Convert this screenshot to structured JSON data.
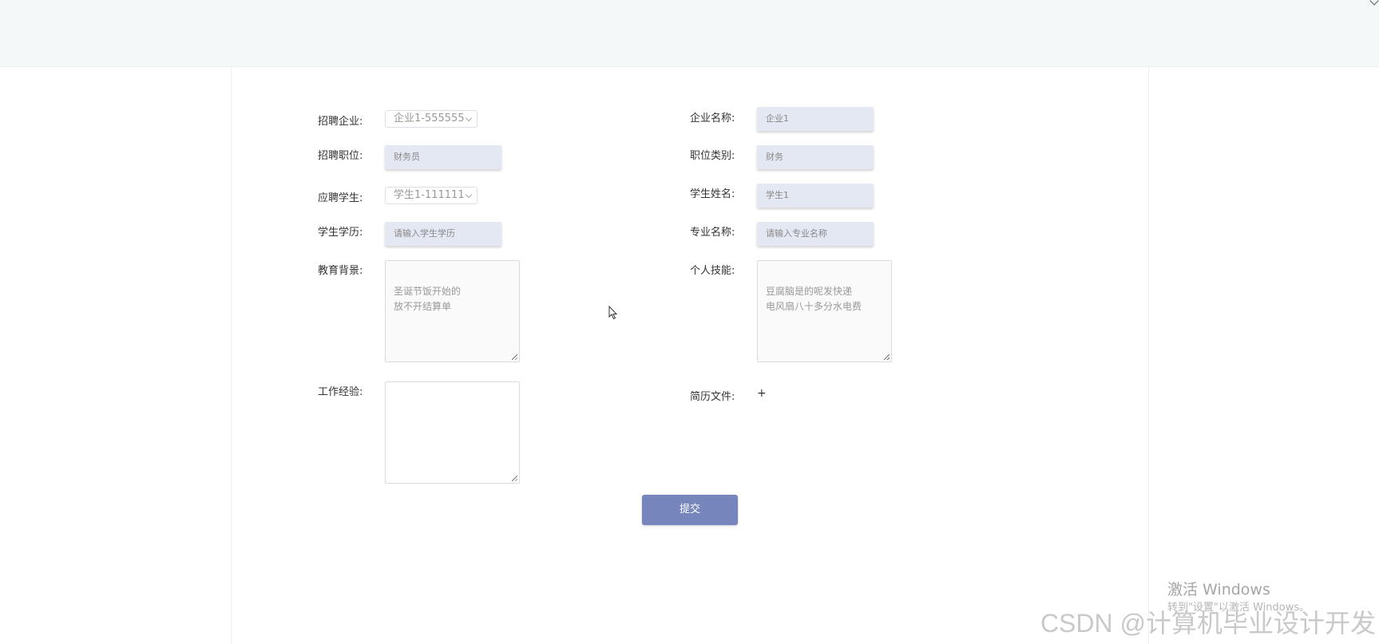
{
  "form": {
    "left": {
      "company_label": "招聘企业:",
      "company_value": "企业1-555555",
      "position_label": "招聘职位:",
      "position_value": "财务员",
      "student_label": "应聘学生:",
      "student_value": "学生1-111111",
      "education_label": "学生学历:",
      "education_placeholder": "请输入学生学历",
      "background_label": "教育背景:",
      "background_value": "圣诞节饭开始的\n放不开结算单",
      "experience_label": "工作经验:",
      "experience_value": ""
    },
    "right": {
      "company_name_label": "企业名称:",
      "company_name_value": "企业1",
      "category_label": "职位类别:",
      "category_value": "财务",
      "student_name_label": "学生姓名:",
      "student_name_value": "学生1",
      "major_label": "专业名称:",
      "major_placeholder": "请输入专业名称",
      "skills_label": "个人技能:",
      "skills_value": "豆腐脑是的呢发快递\n电风扇八十多分水电费",
      "resume_label": "简历文件:",
      "resume_add": "+"
    },
    "submit_label": "提交"
  },
  "overlay": {
    "activate_title": "激活 Windows",
    "activate_sub": "转到\"设置\"以激活 Windows。",
    "watermark": "CSDN @计算机毕业设计开发"
  }
}
